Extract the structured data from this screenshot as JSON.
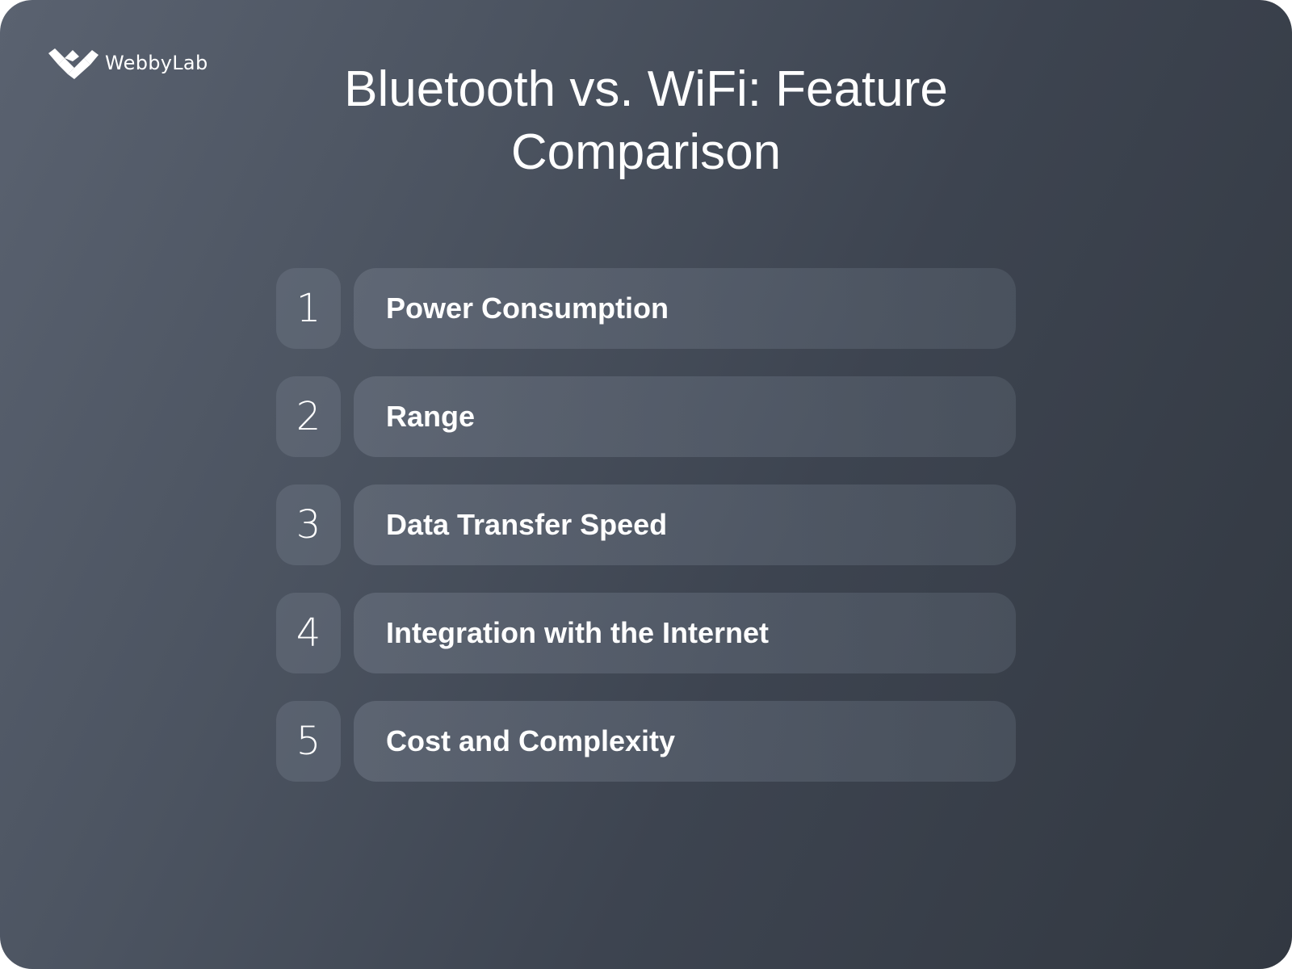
{
  "brand": {
    "logo_icon": "webbylab-logo-icon",
    "name": "WebbyLab"
  },
  "title": "Bluetooth vs. WiFi: Feature Comparison",
  "items": [
    {
      "number": "1",
      "label": "Power Consumption"
    },
    {
      "number": "2",
      "label": "Range"
    },
    {
      "number": "3",
      "label": "Data Transfer Speed"
    },
    {
      "number": "4",
      "label": "Integration with the Internet"
    },
    {
      "number": "5",
      "label": "Cost and Complexity"
    }
  ],
  "colors": {
    "background_start": "#5a6270",
    "background_end": "#323841",
    "text": "#ffffff"
  }
}
